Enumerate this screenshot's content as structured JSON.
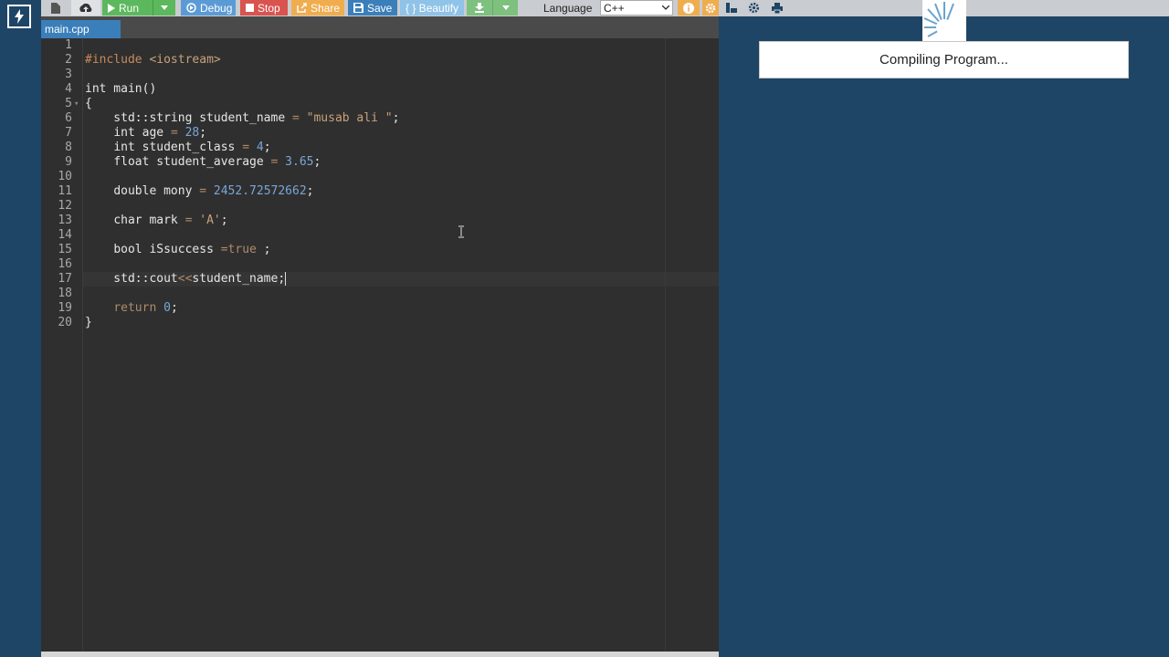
{
  "toolbar": {
    "run_label": "Run",
    "debug_label": "Debug",
    "stop_label": "Stop",
    "share_label": "Share",
    "save_label": "Save",
    "beautify_label": "{ } Beautify",
    "language_label": "Language",
    "language_value": "C++"
  },
  "tab": {
    "filename": "main.cpp"
  },
  "editor": {
    "lines": [
      "1",
      "2",
      "3",
      "4",
      "5",
      "6",
      "7",
      "8",
      "9",
      "10",
      "11",
      "12",
      "13",
      "14",
      "15",
      "16",
      "17",
      "18",
      "19",
      "20"
    ]
  },
  "output": {
    "status": "Compiling Program..."
  },
  "colors": {
    "run": "#5cb85c",
    "debug": "#5b9bd5",
    "stop": "#d9534f",
    "share": "#f0ad4e",
    "save": "#3b7fba",
    "beautify": "#8fc3e8",
    "download": "#7ec07e",
    "info": "#f0ad4e",
    "panel_bg": "#1e4566"
  },
  "icons": {
    "new_file": "file-icon",
    "upload": "upload-icon",
    "settings": "gear-icon"
  }
}
